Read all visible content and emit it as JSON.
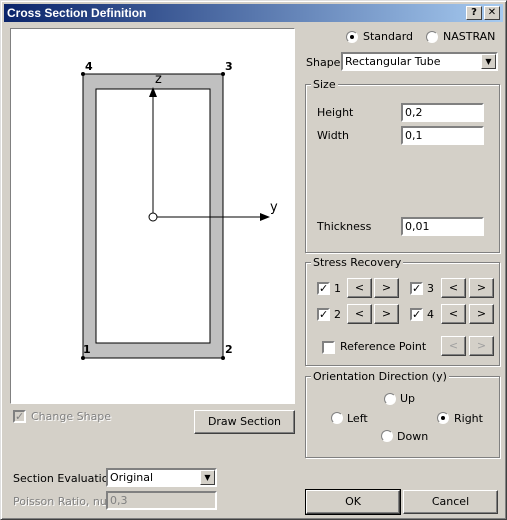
{
  "window": {
    "title": "Cross Section Definition",
    "help_label": "?",
    "close_label": "✕"
  },
  "canvas": {
    "corners": [
      "4",
      "3",
      "2",
      "1"
    ],
    "axis_z_label": "z",
    "axis_y_label": "y"
  },
  "left": {
    "change_shape_label": "Change Shape",
    "draw_section_label": "Draw Section",
    "section_eval_label": "Section Evaluation",
    "section_eval_value": "Original",
    "poisson_label": "Poisson Ratio, nu",
    "poisson_value": "0,3"
  },
  "mode": {
    "standard_label": "Standard",
    "nastran_label": "NASTRAN",
    "selected": "standard"
  },
  "shape": {
    "label": "Shape",
    "value": "Rectangular Tube"
  },
  "size": {
    "title": "Size",
    "height_label": "Height",
    "height_value": "0,2",
    "width_label": "Width",
    "width_value": "0,1",
    "thickness_label": "Thickness",
    "thickness_value": "0,01"
  },
  "stress": {
    "title": "Stress Recovery",
    "points": [
      "1",
      "3",
      "2",
      "4"
    ],
    "prev_label": "<",
    "next_label": ">",
    "ref_point_label": "Reference Point"
  },
  "orientation": {
    "title": "Orientation Direction (y)",
    "up_label": "Up",
    "left_label": "Left",
    "right_label": "Right",
    "down_label": "Down",
    "selected": "right"
  },
  "footer": {
    "ok_label": "OK",
    "cancel_label": "Cancel"
  },
  "colors": {
    "titlebar_start": "#0a246a",
    "titlebar_end": "#a6caf0",
    "dialog_bg": "#d4d0c8",
    "section_fill": "#c0c0c0"
  }
}
